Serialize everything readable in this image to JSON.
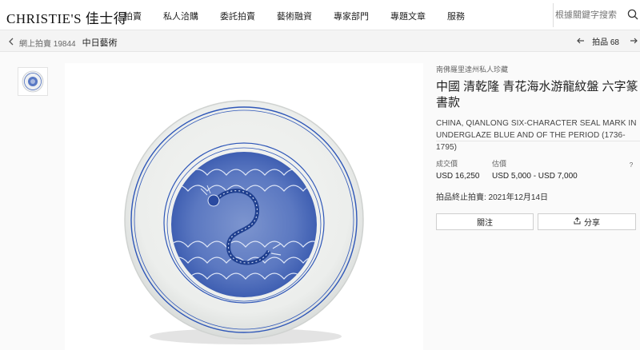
{
  "brand": {
    "logo": "CHRISTIE'S 佳士得"
  },
  "nav": {
    "items": [
      "拍賣",
      "私人洽購",
      "委託拍賣",
      "藝術融資",
      "專家部門",
      "專題文章",
      "服務"
    ]
  },
  "search": {
    "placeholder": "根據關鍵字搜索",
    "icon": "search-icon"
  },
  "breadcrumb": {
    "back_icon": "chevron-left-icon",
    "sale": "網上拍賣 19844",
    "category": "中日藝術"
  },
  "lot_nav": {
    "prev_icon": "arrow-left-icon",
    "label": "拍品 68",
    "next_icon": "arrow-right-icon"
  },
  "lot": {
    "collection": "南佛羅里達州私人珍藏",
    "title_cn": "中國 清乾隆 青花海水游龍紋盤 六字篆書款",
    "title_en": "CHINA, QIANLONG SIX-CHARACTER SEAL MARK IN UNDERGLAZE BLUE AND OF THE PERIOD (1736-1795)",
    "sold_label": "成交價",
    "sold_value": "USD 16,250",
    "estimate_label": "估價",
    "estimate_value": "USD 5,000 - USD 7,000",
    "help_label": "?",
    "end_date": "拍品終止拍賣: 2021年12月14日",
    "follow_label": "關注",
    "share_label": "分享"
  },
  "colors": {
    "underglaze_blue": "#2f57b8",
    "porcelain": "#f1f2f0",
    "text": "#222222"
  }
}
